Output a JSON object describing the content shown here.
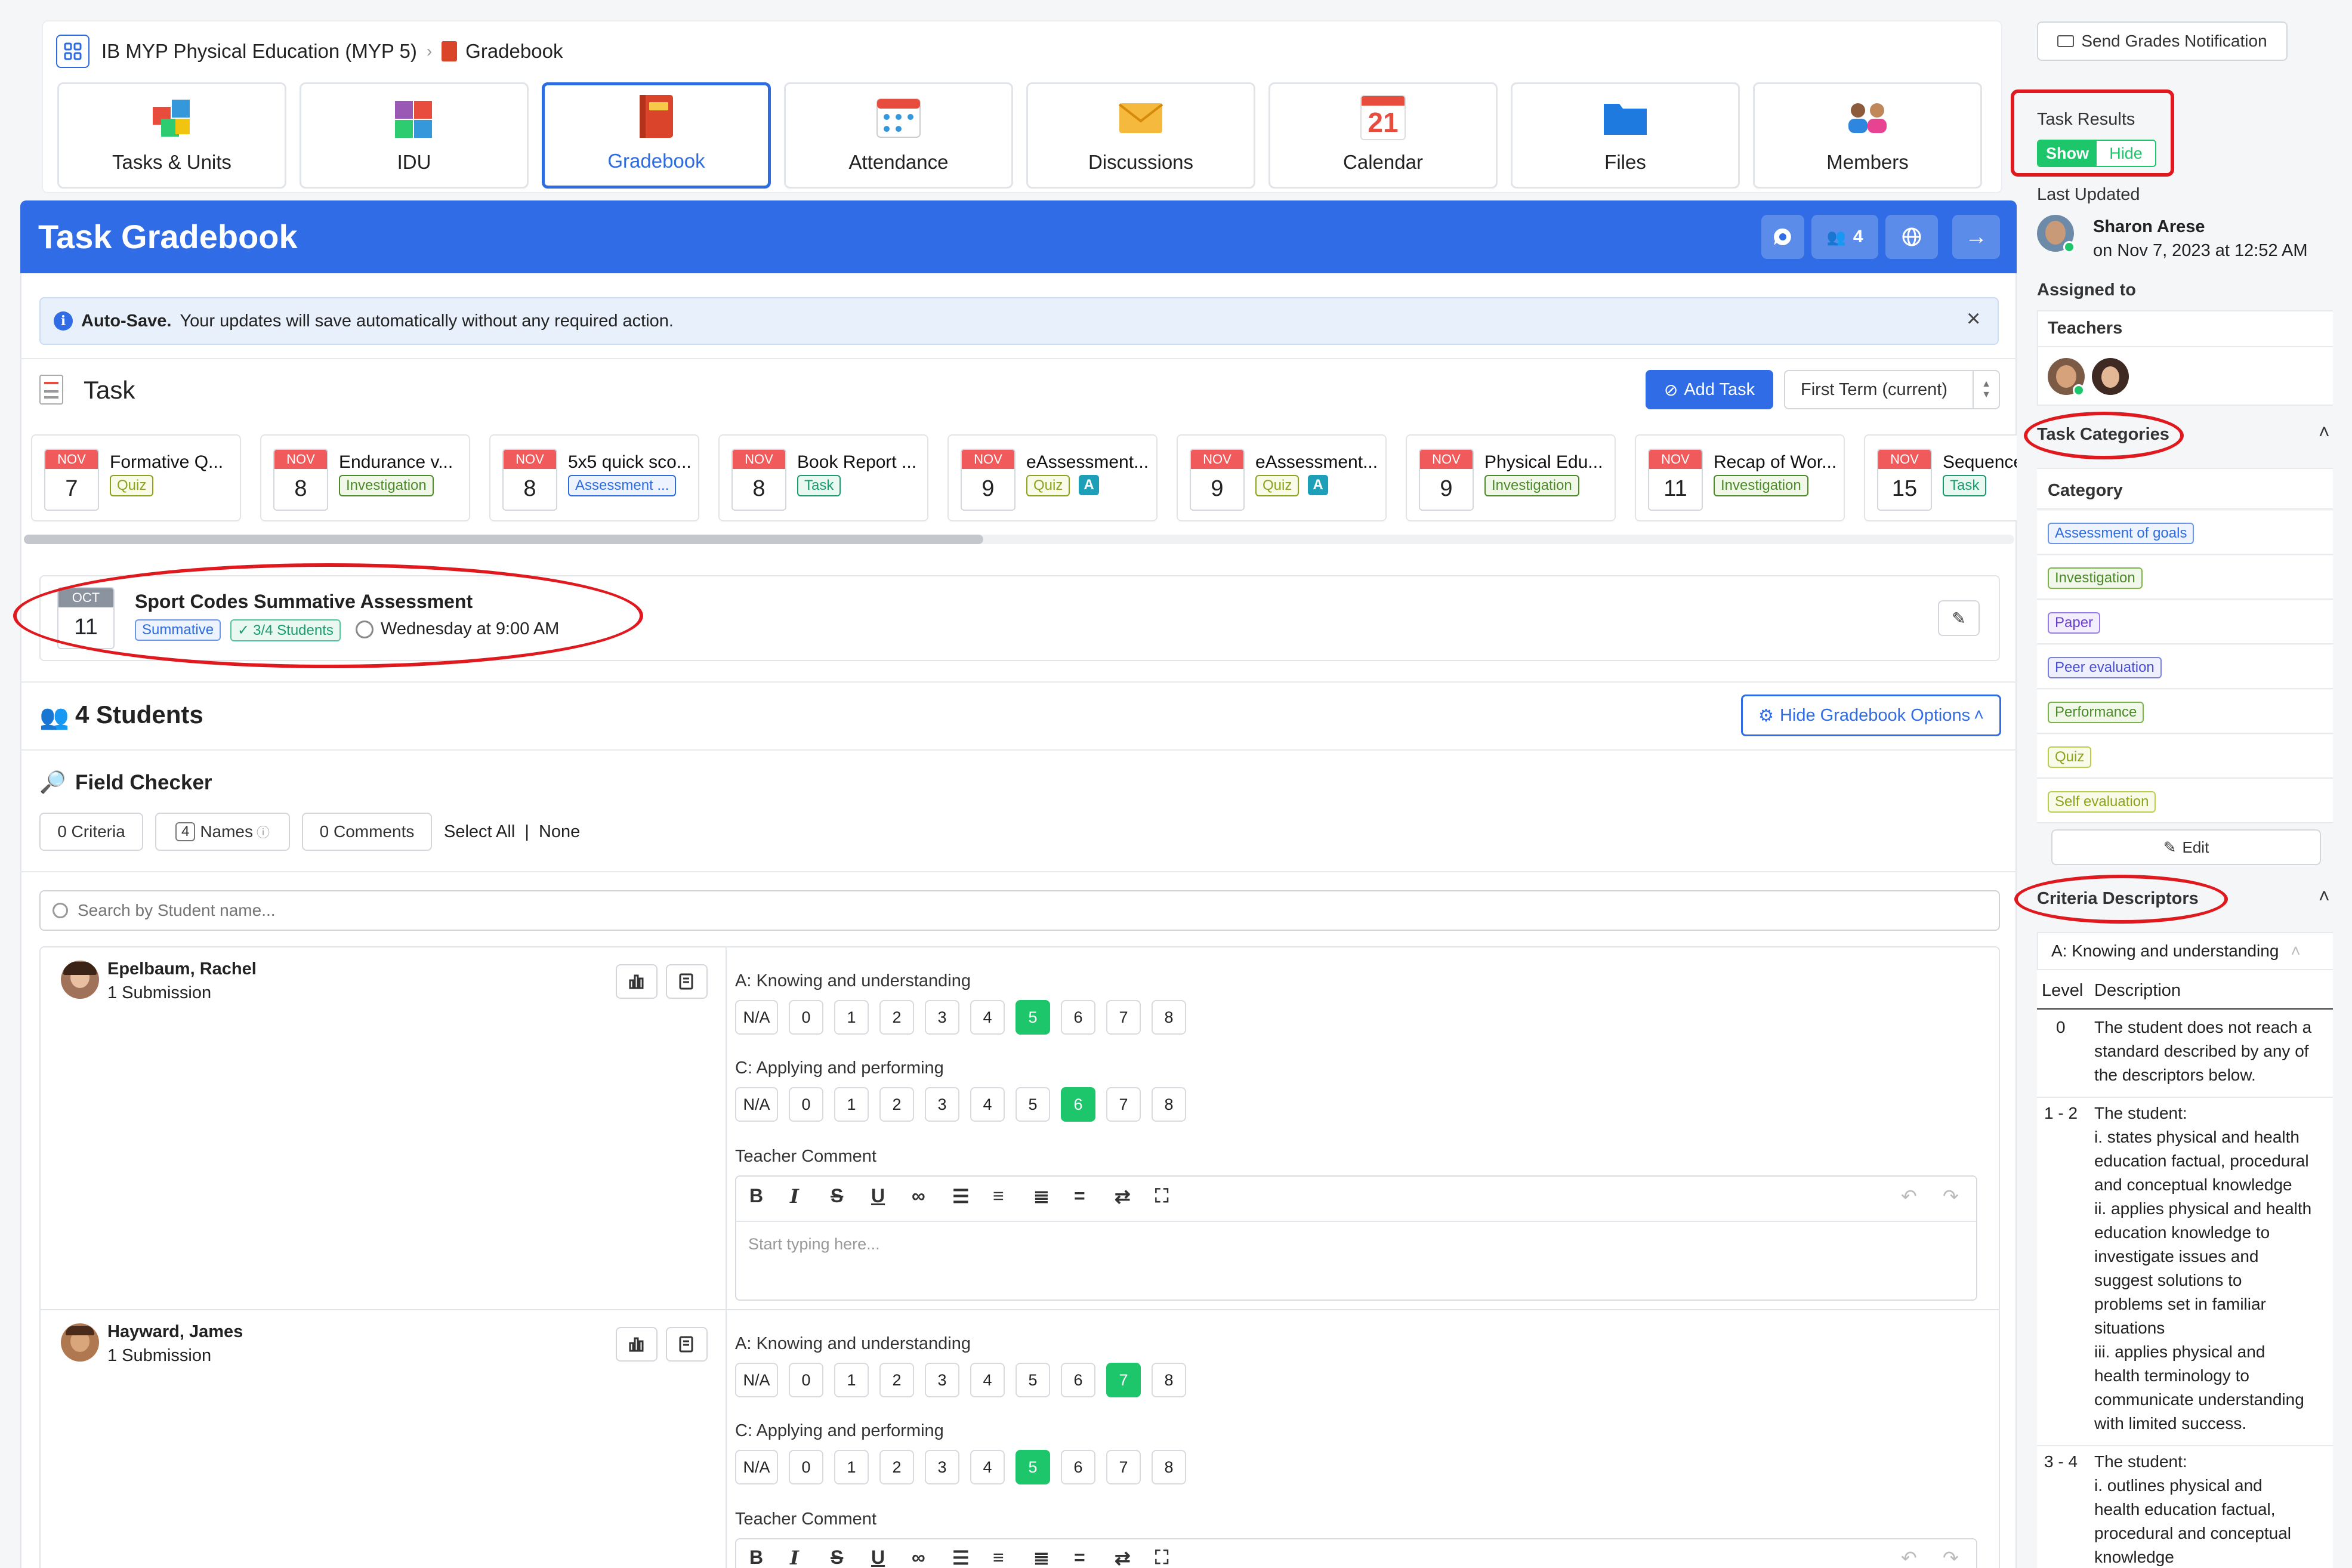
{
  "breadcrumb": {
    "course": "IB MYP Physical Education (MYP 5)",
    "page": "Gradebook"
  },
  "nav": [
    {
      "label": "Tasks & Units",
      "icon": "puzzle-icon"
    },
    {
      "label": "IDU",
      "icon": "puzzle-icon"
    },
    {
      "label": "Gradebook",
      "icon": "gradebook-icon",
      "active": true
    },
    {
      "label": "Attendance",
      "icon": "attendance-icon"
    },
    {
      "label": "Discussions",
      "icon": "envelope-icon"
    },
    {
      "label": "Calendar",
      "icon": "calendar-icon",
      "day": "21"
    },
    {
      "label": "Files",
      "icon": "folder-icon"
    },
    {
      "label": "Members",
      "icon": "members-icon"
    }
  ],
  "header": {
    "title": "Task Gradebook",
    "members_count": "4"
  },
  "autosave": {
    "label": "Auto-Save.",
    "text": "Your updates will save automatically without any required action."
  },
  "task_section": {
    "title": "Task",
    "add_task": "Add Task",
    "term": "First Term (current)"
  },
  "task_cards": [
    {
      "month": "NOV",
      "day": "7",
      "title": "Formative Q...",
      "badge": "Quiz",
      "badge_type": "quiz"
    },
    {
      "month": "NOV",
      "day": "8",
      "title": "Endurance v...",
      "badge": "Investigation",
      "badge_type": "inv"
    },
    {
      "month": "NOV",
      "day": "8",
      "title": "5x5 quick sco...",
      "badge": "Assessment ...",
      "badge_type": "ass"
    },
    {
      "month": "NOV",
      "day": "8",
      "title": "Book Report ...",
      "badge": "Task",
      "badge_type": "task"
    },
    {
      "month": "NOV",
      "day": "9",
      "title": "eAssessment...",
      "badge": "Quiz",
      "badge_type": "quiz",
      "extra": "A"
    },
    {
      "month": "NOV",
      "day": "9",
      "title": "eAssessment...",
      "badge": "Quiz",
      "badge_type": "quiz",
      "extra": "A"
    },
    {
      "month": "NOV",
      "day": "9",
      "title": "Physical Edu...",
      "badge": "Investigation",
      "badge_type": "inv"
    },
    {
      "month": "NOV",
      "day": "11",
      "title": "Recap of Wor...",
      "badge": "Investigation",
      "badge_type": "inv"
    },
    {
      "month": "NOV",
      "day": "15",
      "title": "Sequence",
      "badge": "Task",
      "badge_type": "task"
    }
  ],
  "selected_task": {
    "month": "OCT",
    "day": "11",
    "title": "Sport Codes Summative Assessment",
    "type": "Summative",
    "students": "3/4 Students",
    "when": "Wednesday at 9:00 AM"
  },
  "students_section": {
    "title": "4 Students",
    "options_button": "Hide Gradebook Options"
  },
  "field_checker": {
    "title": "Field Checker",
    "criteria": "0 Criteria",
    "names_count": "4",
    "names": "Names",
    "comments": "0 Comments",
    "select_all": "Select All",
    "sep": "|",
    "none": "None"
  },
  "search": {
    "placeholder": "Search by Student name..."
  },
  "students": [
    {
      "name": "Epelbaum, Rachel",
      "submissions": "1 Submission",
      "crit_a": "A: Knowing and understanding",
      "a_selected": "5",
      "crit_c": "C: Applying and performing",
      "c_selected": "6",
      "comment_label": "Teacher Comment",
      "comment_placeholder": "Start typing here..."
    },
    {
      "name": "Hayward, James",
      "submissions": "1 Submission",
      "crit_a": "A: Knowing and understanding",
      "a_selected": "7",
      "crit_c": "C: Applying and performing",
      "c_selected": "5",
      "comment_label": "Teacher Comment"
    }
  ],
  "levels": [
    "N/A",
    "0",
    "1",
    "2",
    "3",
    "4",
    "5",
    "6",
    "7",
    "8"
  ],
  "sidebar": {
    "send_grades": "Send Grades Notification",
    "task_results": "Task Results",
    "show": "Show",
    "hide": "Hide",
    "last_updated": "Last Updated",
    "updater": "Sharon Arese",
    "updated_on": "on Nov 7, 2023 at 12:52 AM",
    "assigned_to": "Assigned to",
    "teachers": "Teachers",
    "task_categories": "Task Categories",
    "category": "Category",
    "categories": [
      {
        "label": "Assessment of goals",
        "type": "ass"
      },
      {
        "label": "Investigation",
        "type": "inv"
      },
      {
        "label": "Paper",
        "type": "paper"
      },
      {
        "label": "Peer evaluation",
        "type": "peer"
      },
      {
        "label": "Performance",
        "type": "perf"
      },
      {
        "label": "Quiz",
        "type": "quiz"
      },
      {
        "label": "Self evaluation",
        "type": "self"
      }
    ],
    "edit": "Edit",
    "criteria_descriptors": "Criteria Descriptors",
    "criterion": "A: Knowing and understanding",
    "level_col": "Level",
    "desc_col": "Description",
    "descriptors": [
      {
        "level": "0",
        "lines": [
          "The student does not reach a",
          "standard described by any of",
          "the descriptors below."
        ]
      },
      {
        "level": "1 - 2",
        "lines": [
          "The student:",
          "i. states physical and health",
          "education factual, procedural",
          "and conceptual knowledge",
          "ii. applies physical and health",
          "education knowledge to",
          "investigate issues and",
          "suggest solutions to",
          "problems set in familiar",
          "situations",
          "iii. applies physical and",
          "health terminology to",
          "communicate understanding",
          "with limited success."
        ]
      },
      {
        "level": "3 - 4",
        "lines": [
          "The student:",
          "i. outlines physical and",
          "health education factual,",
          "procedural and conceptual",
          "knowledge"
        ]
      }
    ]
  }
}
